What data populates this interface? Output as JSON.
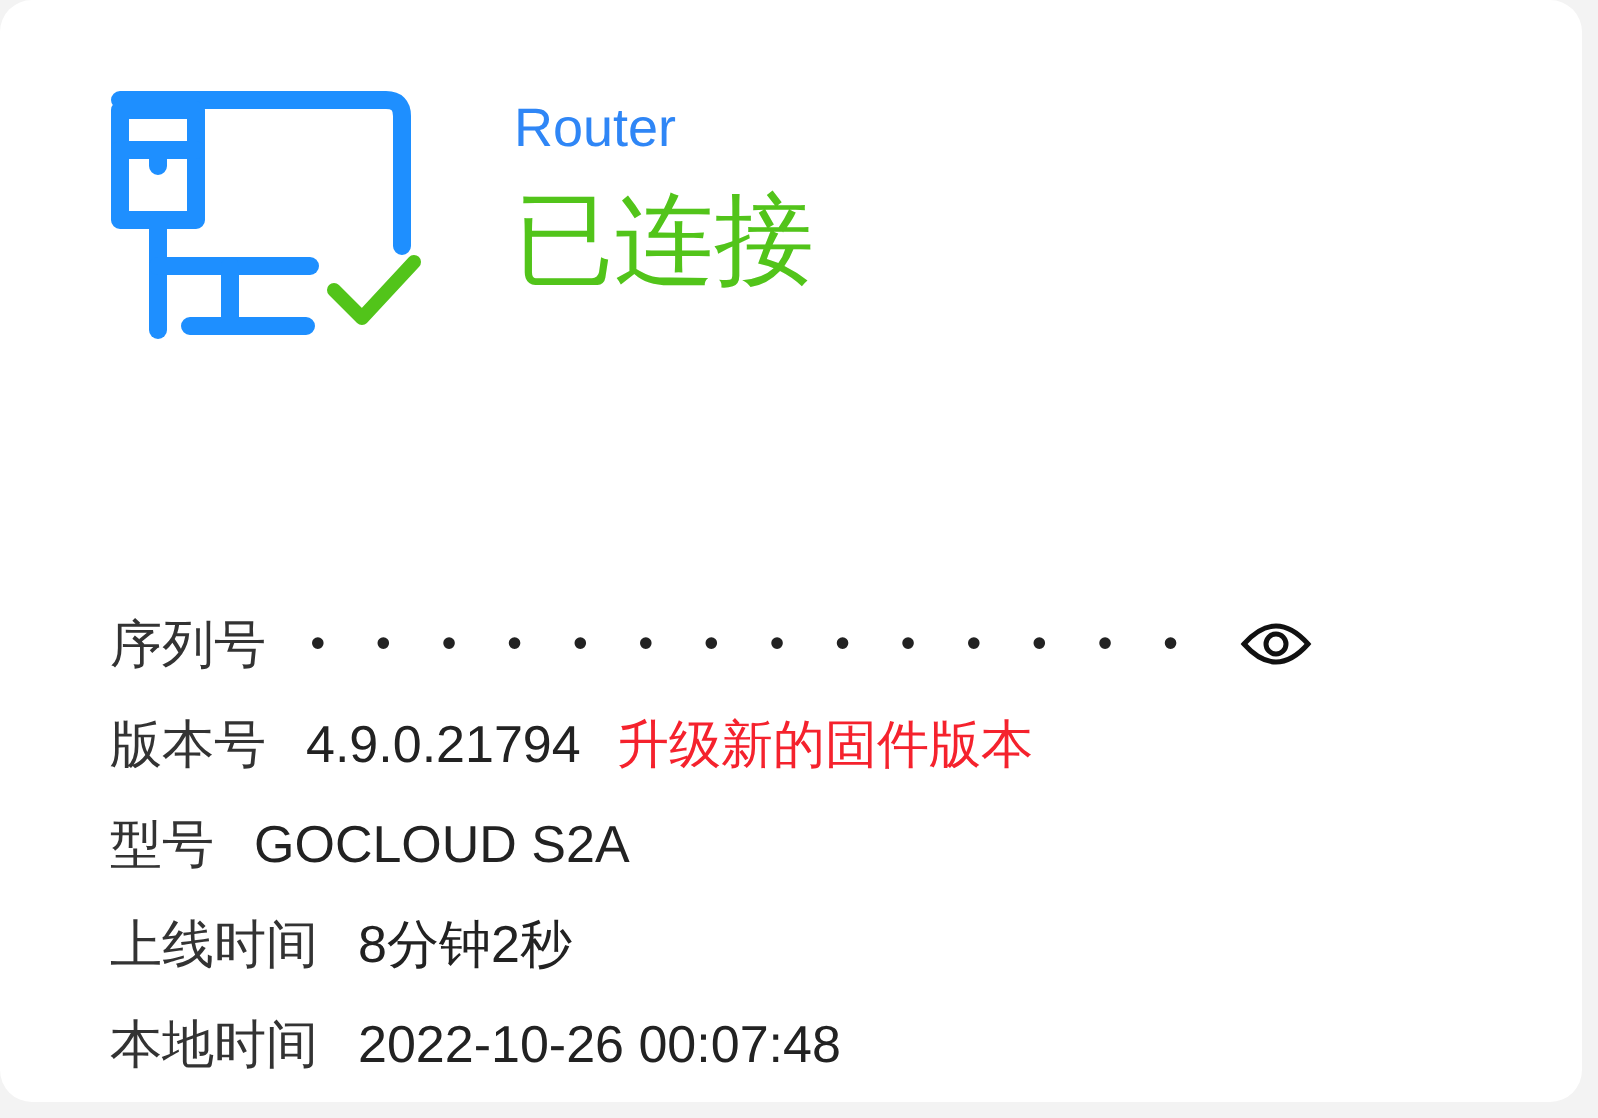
{
  "device": {
    "type": "Router",
    "status": "已连接",
    "connected": true
  },
  "details": [
    {
      "kind": "secret",
      "label": "序列号",
      "value": "••••••••••••••"
    },
    {
      "kind": "text",
      "label": "版本号",
      "value": "4.9.0.21794",
      "link": "升级新的固件版本"
    },
    {
      "kind": "text",
      "label": "型号",
      "value": "GOCLOUD S2A"
    },
    {
      "kind": "text",
      "label": "上线时间",
      "value": "8分钟2秒"
    },
    {
      "kind": "text",
      "label": "本地时间",
      "value": "2022-10-26 00:07:48"
    }
  ]
}
